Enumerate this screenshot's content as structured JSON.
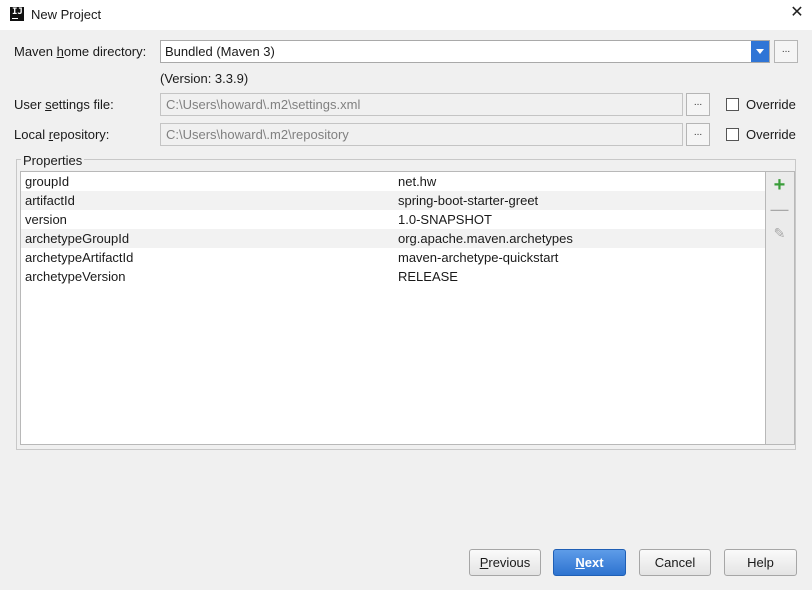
{
  "window": {
    "title": "New Project"
  },
  "maven_home": {
    "label_pre": "Maven ",
    "label_mnemonic": "h",
    "label_post": "ome directory:",
    "value": "Bundled (Maven 3)",
    "browse_label": "...",
    "version_note": "(Version: 3.3.9)"
  },
  "user_settings": {
    "label_pre": "User ",
    "label_mnemonic": "s",
    "label_post": "ettings file:",
    "value": "C:\\Users\\howard\\.m2\\settings.xml",
    "browse_label": "...",
    "override_label": "Override",
    "override_checked": false
  },
  "local_repo": {
    "label_pre": "Local ",
    "label_mnemonic": "r",
    "label_post": "epository:",
    "value": "C:\\Users\\howard\\.m2\\repository",
    "browse_label": "...",
    "override_label": "Override",
    "override_checked": false
  },
  "properties": {
    "title": "Properties",
    "rows": [
      {
        "key": "groupId",
        "value": "net.hw"
      },
      {
        "key": "artifactId",
        "value": "spring-boot-starter-greet"
      },
      {
        "key": "version",
        "value": "1.0-SNAPSHOT"
      },
      {
        "key": "archetypeGroupId",
        "value": "org.apache.maven.archetypes"
      },
      {
        "key": "archetypeArtifactId",
        "value": "maven-archetype-quickstart"
      },
      {
        "key": "archetypeVersion",
        "value": "RELEASE"
      }
    ],
    "toolbar": {
      "add_icon": "+",
      "remove_icon": "—",
      "edit_icon": "✎"
    }
  },
  "buttons": {
    "previous_mnemonic": "P",
    "previous_rest": "revious",
    "next_mnemonic": "N",
    "next_rest": "ext",
    "cancel": "Cancel",
    "help": "Help"
  },
  "colors": {
    "accent": "#2f75d6",
    "add_green": "#3a9d3a"
  }
}
